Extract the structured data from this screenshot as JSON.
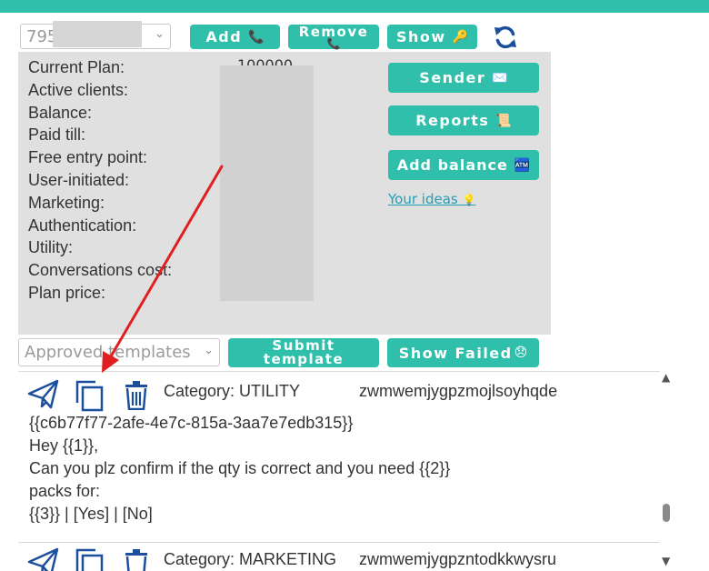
{
  "toolbar": {
    "account_select_value": "795",
    "add_label": "Add",
    "add_emoji": "📞",
    "remove_label": "Remove",
    "remove_emoji": "📞",
    "show_label": "Show",
    "show_emoji": "🔑"
  },
  "info": {
    "labels": [
      "Current Plan:",
      "Active clients:",
      "Balance:",
      "Paid till:",
      "Free entry point:",
      "User-initiated:",
      "Marketing:",
      "Authentication:",
      "Utility:",
      "Conversations cost:",
      "Plan price:"
    ],
    "current_plan_value": "100000"
  },
  "side": {
    "sender_label": "Sender",
    "sender_emoji": "✉️",
    "reports_label": "Reports",
    "reports_emoji": "📜",
    "add_balance_label": "Add balance",
    "add_balance_emoji": "🏧",
    "ideas_label": "Your ideas",
    "ideas_emoji": "💡"
  },
  "controls": {
    "templates_select_value": "Approved templates",
    "submit_label_line1": "Submit",
    "submit_label_line2": "template",
    "show_failed_label": "Show Failed",
    "show_failed_emoji": "😞"
  },
  "templates": [
    {
      "category": "Category: UTILITY",
      "name": "zwmwemjygpzmojlsoyhqde",
      "lines": [
        "{{c6b77f77-2afe-4e7c-815a-3aa7e7edb315}}",
        "Hey {{1}},",
        "Can you plz confirm if the qty is correct and you need {{2}}",
        "packs for:",
        "{{3}} | [Yes] | [No]"
      ]
    },
    {
      "category": "Category: MARKETING",
      "name": "zwmwemjygpzntodkkwysru"
    }
  ],
  "colors": {
    "accent": "#2fbfaa",
    "icon_blue": "#1b4f9c",
    "arrow_red": "#e02020",
    "panel_bg": "#e0e0e0"
  },
  "icons": [
    "refresh-icon",
    "send-icon",
    "copy-icon",
    "trash-icon",
    "chevron-down-icon"
  ],
  "scroll": {
    "position_fraction": 0.78
  }
}
